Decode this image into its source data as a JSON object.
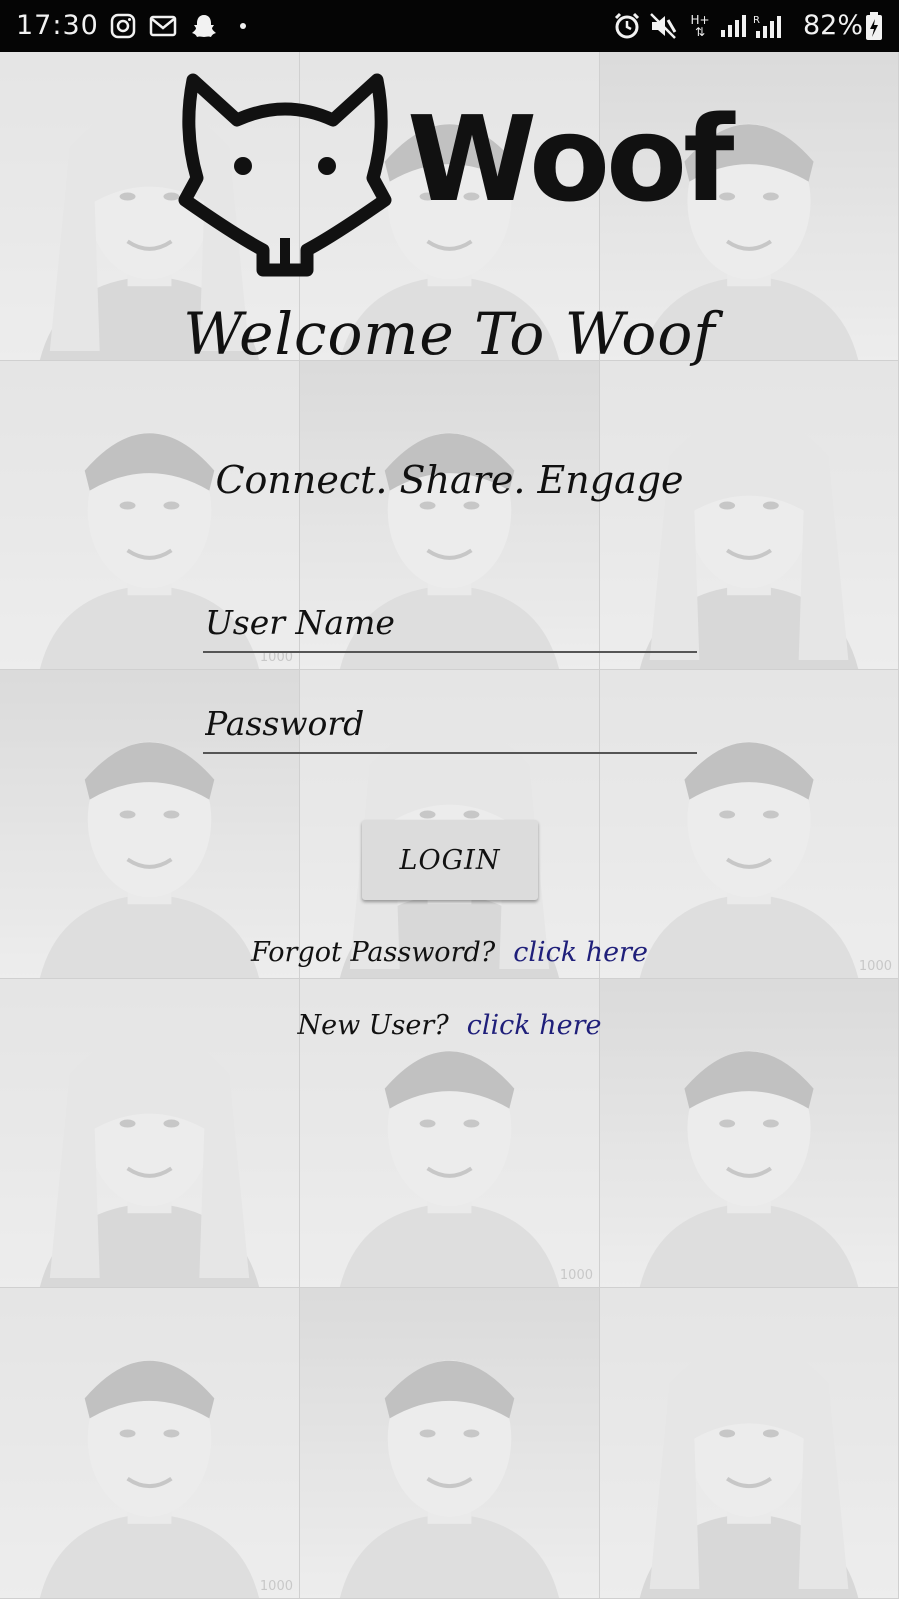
{
  "status_bar": {
    "time": "17:30",
    "battery_percent": "82%",
    "network_label": "H+",
    "icons": [
      "instagram-icon",
      "gmail-icon",
      "snapchat-icon",
      "dot-icon",
      "alarm-icon",
      "mute-icon",
      "data-arrows-icon",
      "signal-icon",
      "roaming-signal-icon",
      "battery-icon"
    ]
  },
  "background": {
    "watermark": "1000"
  },
  "brand": {
    "logo_text": "Woof",
    "logo_icon": "fox-icon"
  },
  "welcome_title": "Welcome To Woof",
  "tagline": "Connect. Share. Engage",
  "form": {
    "username_placeholder": "User Name",
    "password_placeholder": "Password",
    "login_label": "LOGIN"
  },
  "links": {
    "forgot_prompt": "Forgot Password?",
    "forgot_link": "click here",
    "new_user_prompt": "New User?",
    "new_user_link": "click here"
  },
  "colors": {
    "status_bar": "#050505",
    "link": "#1f1f7a",
    "button": "#dcdcdc",
    "text": "#111111"
  }
}
